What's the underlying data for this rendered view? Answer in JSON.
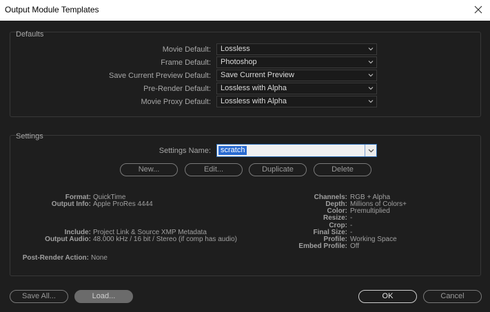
{
  "window": {
    "title": "Output Module Templates"
  },
  "defaults": {
    "label": "Defaults",
    "rows": [
      {
        "label": "Movie Default:",
        "value": "Lossless"
      },
      {
        "label": "Frame Default:",
        "value": "Photoshop"
      },
      {
        "label": "Save Current Preview Default:",
        "value": "Save Current Preview"
      },
      {
        "label": "Pre-Render Default:",
        "value": "Lossless with Alpha"
      },
      {
        "label": "Movie Proxy Default:",
        "value": "Lossless with Alpha"
      }
    ]
  },
  "settings": {
    "label": "Settings",
    "name_label": "Settings Name:",
    "name_value": "scratch",
    "buttons": {
      "new": "New...",
      "edit": "Edit...",
      "duplicate": "Duplicate",
      "delete": "Delete"
    },
    "format_label": "Format:",
    "format": "QuickTime",
    "output_info_label": "Output Info:",
    "output_info": "Apple ProRes 4444",
    "include_label": "Include:",
    "include": "Project Link & Source XMP Metadata",
    "output_audio_label": "Output Audio:",
    "output_audio": "48.000 kHz / 16 bit / Stereo (if comp has audio)",
    "post_render_label": "Post-Render Action:",
    "post_render": "None",
    "channels_label": "Channels:",
    "channels": "RGB + Alpha",
    "depth_label": "Depth:",
    "depth": "Millions of Colors+",
    "color_label": "Color:",
    "color": "Premultiplied",
    "resize_label": "Resize:",
    "resize": "-",
    "crop_label": "Crop:",
    "crop": "-",
    "final_size_label": "Final Size:",
    "final_size": "-",
    "profile_label": "Profile:",
    "profile": "Working Space",
    "embed_profile_label": "Embed Profile:",
    "embed_profile": "Off"
  },
  "footer": {
    "save_all": "Save All...",
    "load": "Load...",
    "ok": "OK",
    "cancel": "Cancel"
  }
}
